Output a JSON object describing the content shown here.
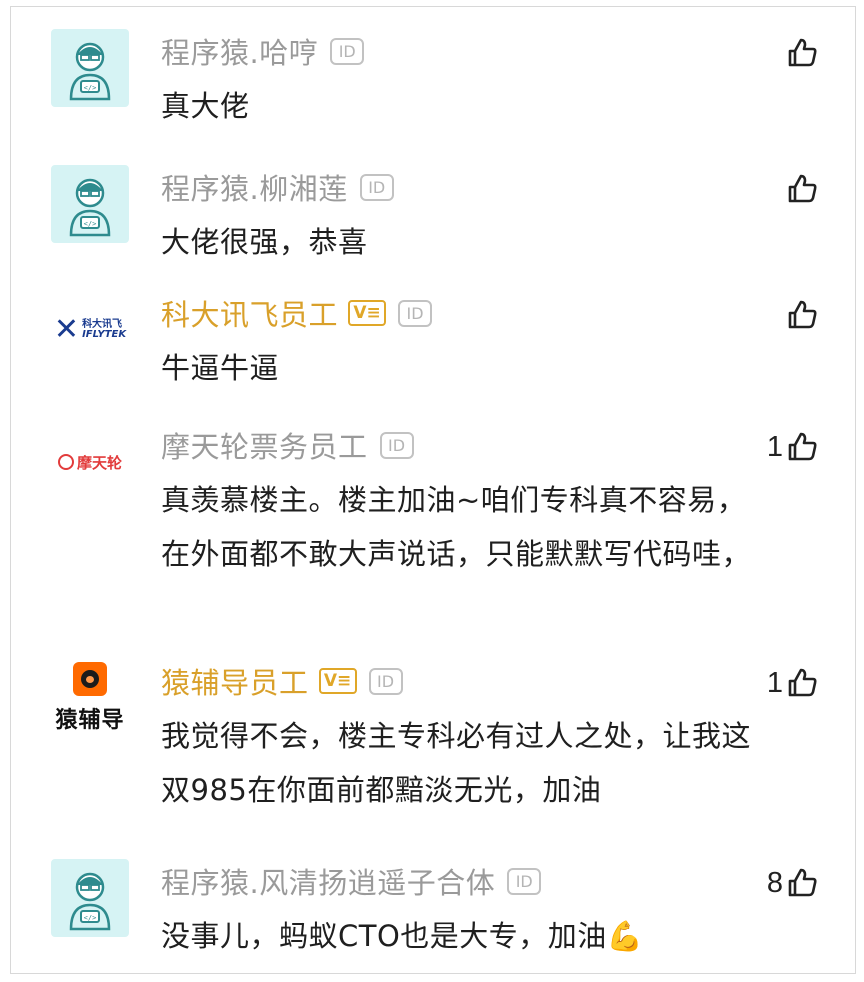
{
  "comments": [
    {
      "name": "程序猿.哈哼",
      "verified": false,
      "avatar": "coder-avatar",
      "text": "真大佬",
      "likes": ""
    },
    {
      "name": "程序猿.柳湘莲",
      "verified": false,
      "avatar": "coder-avatar",
      "text": "大佬很强，恭喜",
      "likes": ""
    },
    {
      "name": "科大讯飞员工",
      "verified": true,
      "avatar": "iflytek-logo",
      "logo_zh": "科大讯飞",
      "logo_en": "IFLYTEK",
      "text": "牛逼牛逼",
      "likes": ""
    },
    {
      "name": "摩天轮票务员工",
      "verified": false,
      "avatar": "motianlun-logo",
      "logo_zh": "摩天轮",
      "text": "真羡慕楼主。楼主加油~咱们专科真不容易，在外面都不敢大声说话，只能默默写代码哇，",
      "likes": "1"
    },
    {
      "name": "猿辅导员工",
      "verified": true,
      "avatar": "yuanfudao-logo",
      "logo_zh": "猿辅导",
      "text": "我觉得不会，楼主专科必有过人之处，让我这双985在你面前都黯淡无光，加油",
      "likes": "1"
    },
    {
      "name": "程序猿.风清扬逍遥子合体",
      "verified": false,
      "avatar": "coder-avatar",
      "text": "没事儿，蚂蚁CTO也是大专，加油💪",
      "likes": "8"
    }
  ],
  "badges": {
    "verified": "V≡",
    "id": "ID"
  },
  "colors": {
    "name_gray": "#9a9a9a",
    "name_gold": "#d9a02a",
    "coder_bg": "#d6f3f4",
    "coder_line": "#2e8b8e"
  },
  "icons": {
    "like": "thumbs-up-icon"
  }
}
